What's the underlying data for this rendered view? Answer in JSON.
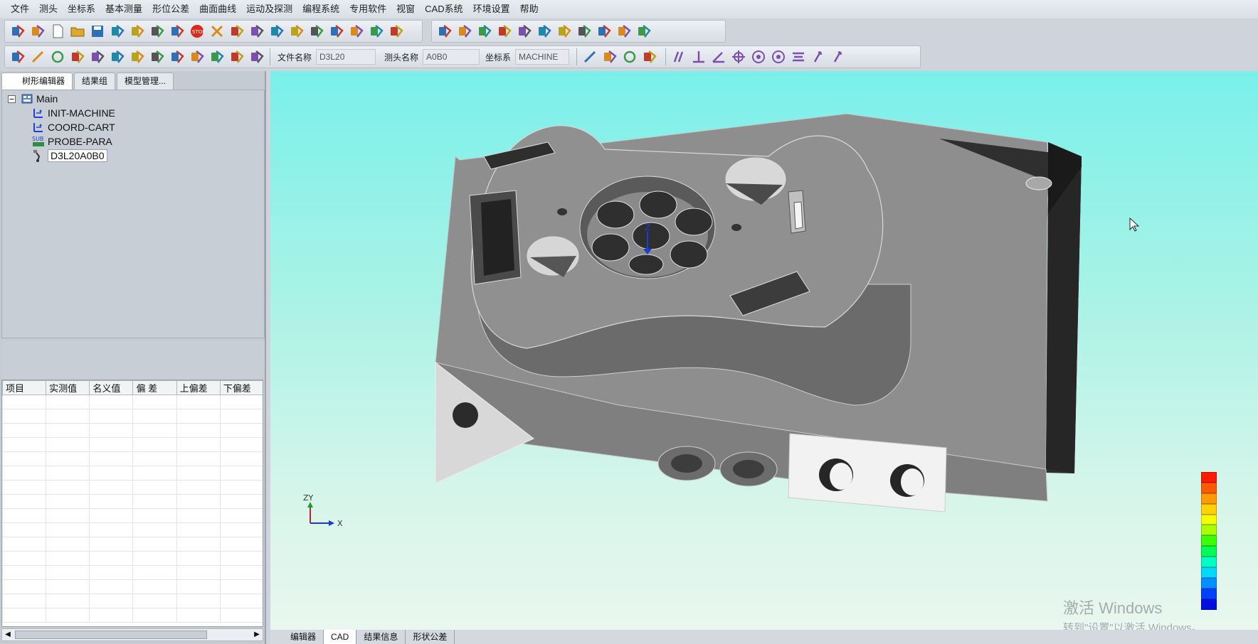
{
  "menu": [
    "文件",
    "测头",
    "坐标系",
    "基本测量",
    "形位公差",
    "曲面曲线",
    "运动及探测",
    "编程系统",
    "专用软件",
    "视窗",
    "CAD系统",
    "环境设置",
    "帮助"
  ],
  "fields": {
    "file_label": "文件名称",
    "file_value": "D3L20",
    "probe_label": "测头名称",
    "probe_value": "A0B0",
    "coord_label": "坐标系",
    "coord_value": "MACHINE"
  },
  "left_tabs": [
    "树形编辑器",
    "结果组",
    "模型管理..."
  ],
  "tree": {
    "root": "Main",
    "children": [
      "INIT-MACHINE",
      "COORD-CART",
      "PROBE-PARA",
      "D3L20A0B0"
    ]
  },
  "measure": {
    "count": "0",
    "name_value": ""
  },
  "results_table": {
    "headers": [
      "项目",
      "实测值",
      "名义值",
      "偏 差",
      "上偏差",
      "下偏差"
    ]
  },
  "axis_labels": {
    "y": "ZY",
    "x": "X",
    "z": "Z"
  },
  "bottom_tabs": [
    "编辑器",
    "CAD",
    "结果信息",
    "形状公差"
  ],
  "watermark": {
    "line1": "激活 Windows",
    "line2": "转到\"设置\"以激活 Windows。"
  },
  "colorbar": [
    "#ff1a00",
    "#ff5a00",
    "#ff9a00",
    "#ffd200",
    "#f3ff00",
    "#a8ff00",
    "#3cff00",
    "#00ff54",
    "#00ffc2",
    "#00d8ff",
    "#0090ff",
    "#0040ff",
    "#0010e0"
  ],
  "colors": {
    "part": "#8f8f8f",
    "part_light": "#bdbdbd",
    "part_dark": "#3d3d3d",
    "viewport_top": "#7af0ea"
  },
  "icons": {
    "toolbar1": [
      "open-icon",
      "print-preview-icon",
      "new-icon",
      "folder-icon",
      "save-icon",
      "copy-icon",
      "unlock-icon",
      "measure-icon",
      "edit-icon",
      "stop-icon",
      "delete-icon",
      "tool-icon",
      "align-icon",
      "align2-icon",
      "bars-icon",
      "cone-icon",
      "probe-icon",
      "arm-icon",
      "wave-icon",
      "lbar-icon",
      "print-icon",
      "printer-icon",
      "export-icon",
      "home-icon",
      "layers-icon",
      "spin-icon",
      "pen-icon",
      "joystick-icon",
      "green-icon",
      "chart-icon",
      "sub-icon"
    ],
    "toolbar2": [
      "point-icon",
      "line-icon",
      "circle-icon",
      "arc-icon",
      "ellipse-icon",
      "slot-icon",
      "cylinder-icon",
      "sphere-icon",
      "cone-icon",
      "plane-icon",
      "box-icon",
      "torus-icon",
      "feature-icon"
    ],
    "toolbar3": [
      "line-tol-icon",
      "rect-tol-icon",
      "circle-tol-icon",
      "cylinder-tol-icon"
    ],
    "toolbar4": [
      "parallel-icon",
      "perpendicular-icon",
      "angle-icon",
      "position-icon",
      "concentric-icon",
      "coaxial-icon",
      "symmetry-icon",
      "runout-icon",
      "total-runout-icon"
    ]
  }
}
